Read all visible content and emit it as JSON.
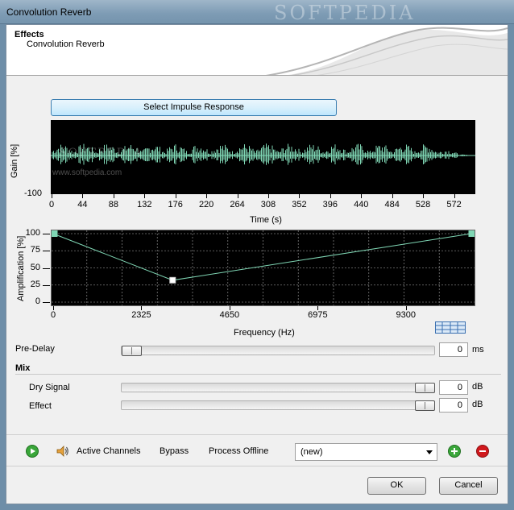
{
  "window": {
    "title": "Convolution Reverb",
    "watermark": "SOFTPEDIA"
  },
  "header": {
    "section": "Effects",
    "subtitle": "Convolution Reverb"
  },
  "impulse": {
    "button_label": "Select Impulse Response"
  },
  "waveform": {
    "ylabel": "Gain [%]",
    "y_tick_bottom": "-100",
    "xlabel": "Time (s)",
    "x_ticks": [
      "0",
      "44",
      "88",
      "132",
      "176",
      "220",
      "264",
      "308",
      "352",
      "396",
      "440",
      "484",
      "528",
      "572"
    ],
    "watermark": "SOFTPEDIA",
    "url_watermark": "www.softpedia.com"
  },
  "chart_data": {
    "type": "line",
    "xlabel": "Frequency (Hz)",
    "ylabel": "Amplification [%]",
    "x_ticks": [
      "0",
      "2325",
      "4650",
      "6975",
      "9300"
    ],
    "y_ticks": [
      "100",
      "75",
      "50",
      "25",
      "0"
    ],
    "xlim": [
      0,
      11025
    ],
    "ylim": [
      0,
      100
    ],
    "x": [
      0,
      3150,
      11025
    ],
    "y": [
      100,
      32,
      100
    ],
    "grid": true,
    "line_color": "#7fd6b4"
  },
  "predelay": {
    "label": "Pre-Delay",
    "value": "0",
    "unit": "ms"
  },
  "mix": {
    "title": "Mix",
    "dry": {
      "label": "Dry Signal",
      "value": "0",
      "unit": "dB"
    },
    "effect": {
      "label": "Effect",
      "value": "0",
      "unit": "dB"
    }
  },
  "toolbar": {
    "active_channels": "Active Channels",
    "bypass": "Bypass",
    "process_offline": "Process Offline",
    "preset_value": "(new)"
  },
  "dialog": {
    "ok": "OK",
    "cancel": "Cancel"
  },
  "colors": {
    "accent": "#3c7fb1",
    "waveform": "#7fd6b4",
    "add": "#2e9d2e",
    "remove": "#d0191d"
  }
}
